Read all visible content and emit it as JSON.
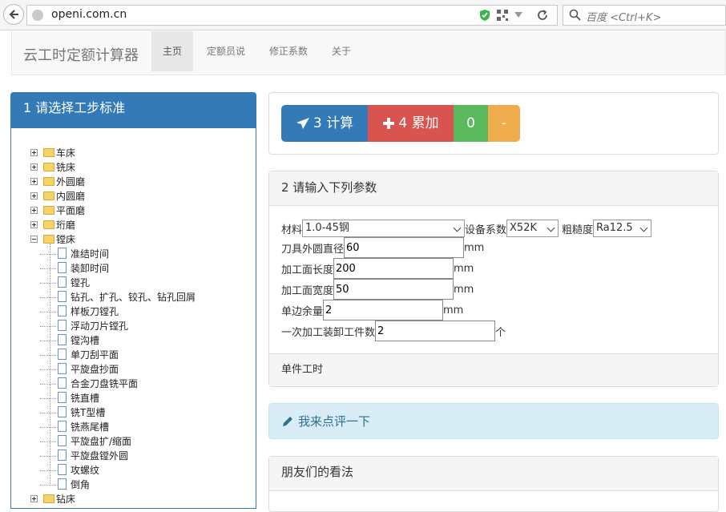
{
  "browser": {
    "url": "openi.com.cn",
    "search_placeholder": "百度 <Ctrl+K>"
  },
  "navbar": {
    "brand": "云工时定额计算器",
    "items": [
      {
        "label": "主页",
        "active": true
      },
      {
        "label": "定额员说",
        "active": false
      },
      {
        "label": "修正系数",
        "active": false
      },
      {
        "label": "关于",
        "active": false
      }
    ]
  },
  "left_panel": {
    "title": "1 请选择工步标准",
    "tree": {
      "top_folders": [
        "车床",
        "铣床",
        "外圆磨",
        "内圆磨",
        "平面磨",
        "珩磨"
      ],
      "open_folder": "镗床",
      "children": [
        "准结时间",
        "装卸时间",
        "镗孔",
        "钻孔、扩孔、铰孔、钻孔回屑",
        "样板刀镗孔",
        "浮动刀片镗孔",
        "镗沟槽",
        "单刀刮平面",
        "平旋盘抄面",
        "合金刀盘铣平面",
        "铣直槽",
        "铣T型槽",
        "铣燕尾槽",
        "平旋盘扩/缩面",
        "平旋盘镗外圆",
        "攻螺纹",
        "倒角"
      ],
      "next_folder": "钻床"
    }
  },
  "actions": {
    "calc_label": "3 计算",
    "accum_label": "4 累加",
    "count_label": "0",
    "minus_label": "-"
  },
  "params": {
    "title": "2 请输入下列参数",
    "material_label": "材料",
    "material_value": "1.0-45钢",
    "equip_label": "设备系数",
    "equip_value": "X52K",
    "rough_label": "粗糙度",
    "rough_value": "Ra12.5",
    "tool_dia_label": "刀具外圆直径",
    "tool_dia_value": "60",
    "length_label": "加工面长度",
    "length_value": "200",
    "width_label": "加工面宽度",
    "width_value": "50",
    "allowance_label": "单边余量",
    "allowance_value": "2",
    "pieces_label": "一次加工装卸工件数",
    "pieces_value": "2",
    "unit_mm": "mm",
    "unit_pieces": "个",
    "footer": "单件工时"
  },
  "comment": {
    "label": "我来点评一下"
  },
  "friends": {
    "title": "朋友们的看法"
  }
}
